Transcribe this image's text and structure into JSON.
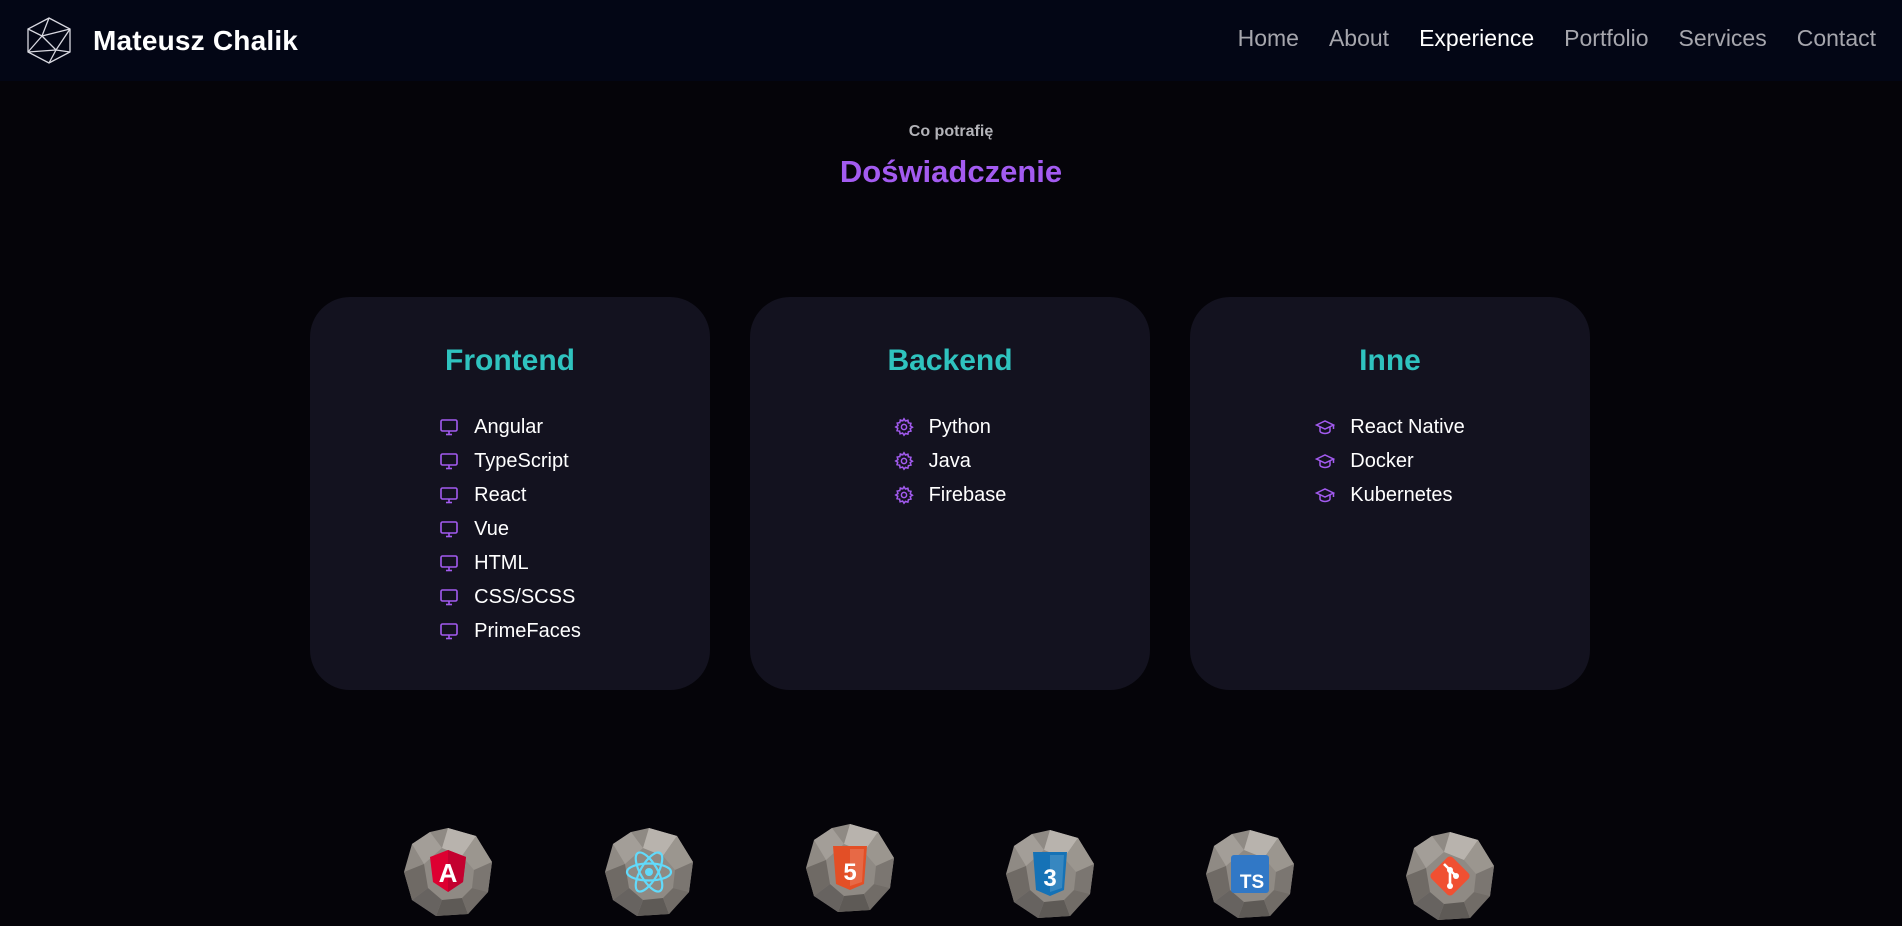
{
  "brand": {
    "name": "Mateusz Chalik",
    "logo_icon": "polyhedron-icon"
  },
  "nav": {
    "items": [
      {
        "label": "Home",
        "active": false
      },
      {
        "label": "About",
        "active": false
      },
      {
        "label": "Experience",
        "active": true
      },
      {
        "label": "Portfolio",
        "active": false
      },
      {
        "label": "Services",
        "active": false
      },
      {
        "label": "Contact",
        "active": false
      }
    ]
  },
  "section": {
    "eyebrow": "Co potrafię",
    "title": "Doświadczenie"
  },
  "cards": [
    {
      "title": "Frontend",
      "icon": "monitor-icon",
      "items": [
        "Angular",
        "TypeScript",
        "React",
        "Vue",
        "HTML",
        "CSS/SCSS",
        "PrimeFaces"
      ]
    },
    {
      "title": "Backend",
      "icon": "gear-icon",
      "items": [
        "Python",
        "Java",
        "Firebase"
      ]
    },
    {
      "title": "Inne",
      "icon": "graduation-cap-icon",
      "items": [
        "React Native",
        "Docker",
        "Kubernetes"
      ]
    }
  ],
  "tech_icons": [
    {
      "name": "angular-icon",
      "color": "#dd0031",
      "glyph": "A"
    },
    {
      "name": "react-icon",
      "color": "#61dafb",
      "glyph": ""
    },
    {
      "name": "html5-icon",
      "color": "#e34f26",
      "glyph": "5"
    },
    {
      "name": "css3-icon",
      "color": "#1572b6",
      "glyph": "3"
    },
    {
      "name": "typescript-icon",
      "color": "#3178c6",
      "glyph": "TS"
    },
    {
      "name": "git-icon",
      "color": "#f05032",
      "glyph": ""
    }
  ],
  "colors": {
    "background": "#050409",
    "navbar": "#030615",
    "card": "#13121f",
    "accent_purple": "#a35bf0",
    "accent_teal": "#2fc3bf"
  }
}
